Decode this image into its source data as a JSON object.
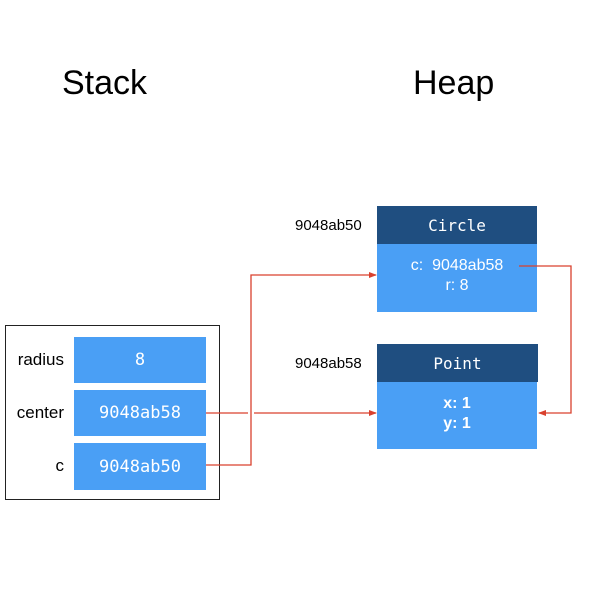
{
  "titles": {
    "stack": "Stack",
    "heap": "Heap"
  },
  "stack": {
    "variables": [
      {
        "name": "radius",
        "value": "8"
      },
      {
        "name": "center",
        "value": "9048ab58"
      },
      {
        "name": "c",
        "value": "9048ab50"
      }
    ]
  },
  "heap": {
    "objects": [
      {
        "address": "9048ab50",
        "type": "Circle",
        "fields": [
          "c:  9048ab58",
          "r: 8"
        ]
      },
      {
        "address": "9048ab58",
        "type": "Point",
        "fields": [
          "x: 1",
          "y: 1"
        ]
      }
    ]
  },
  "colors": {
    "cell": "#4a9ff5",
    "header": "#1f4e80",
    "arrow": "#d9412e"
  }
}
